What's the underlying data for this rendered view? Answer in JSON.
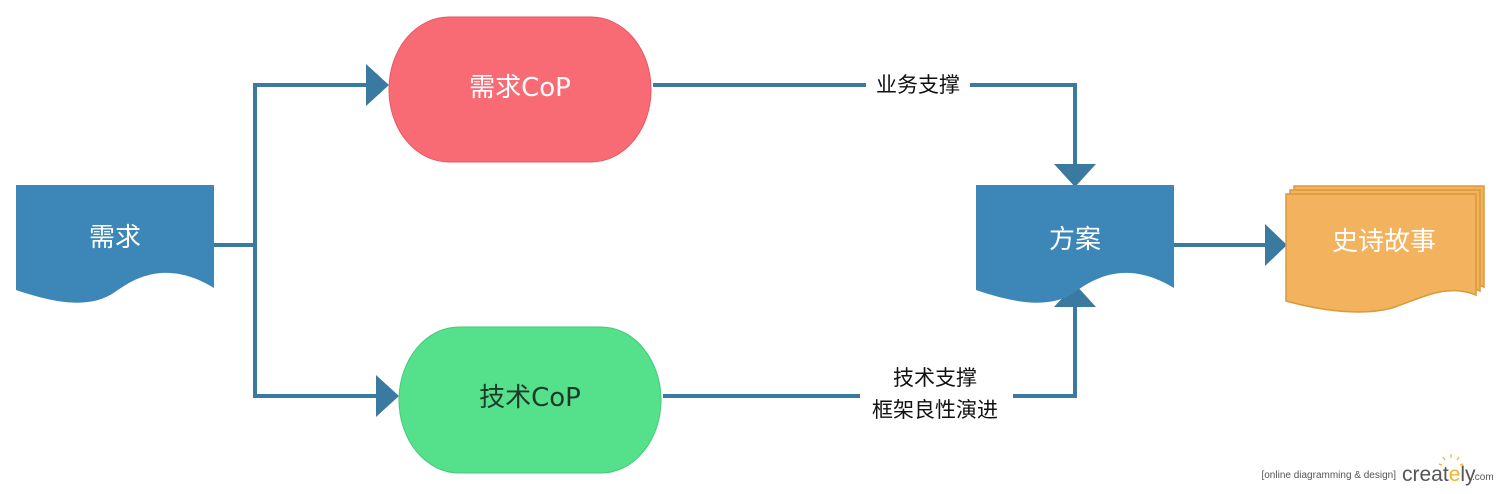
{
  "diagram": {
    "nodes": {
      "demand": {
        "label": "需求"
      },
      "demand_cop": {
        "label": "需求CoP"
      },
      "tech_cop": {
        "label": "技术CoP"
      },
      "solution": {
        "label": "方案"
      },
      "epic": {
        "label": "史诗故事"
      }
    },
    "edges": {
      "business_support": {
        "label": "业务支撑"
      },
      "tech_support": {
        "line1": "技术支撑",
        "line2": "框架良性演进"
      }
    }
  },
  "watermark": {
    "tagline": "[online diagramming & design]",
    "brand_part1": "creat",
    "brand_part2": "ly",
    "domain": ".com"
  },
  "colors": {
    "connector": "#3b7aa0",
    "document_fill": "#3d87b8",
    "demand_cop_fill": "#f96b74",
    "tech_cop_fill": "#55e08c",
    "epic_fill": "#f3b25d",
    "epic_stroke": "#d99a38",
    "brand_gray": "#555555",
    "brand_sun": "#f2b42a"
  }
}
